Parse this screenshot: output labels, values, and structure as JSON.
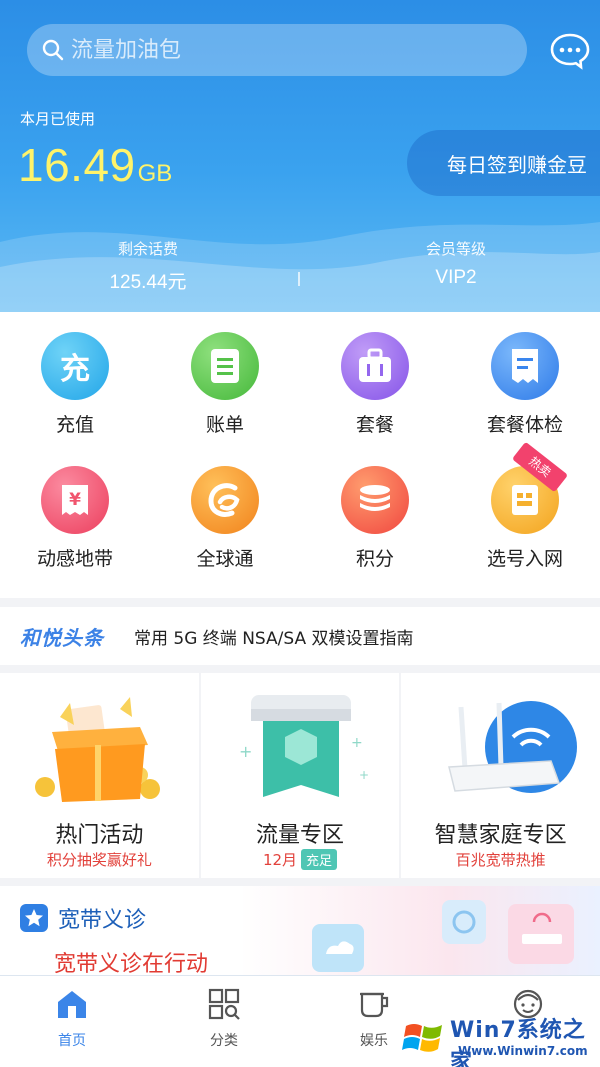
{
  "header": {
    "search_placeholder": "流量加油包",
    "used_label": "本月已使用",
    "used_value": "16.49",
    "used_unit": "GB",
    "checkin_label": "每日签到赚金豆",
    "balance_label": "剩余话费",
    "balance_value": "125.44元",
    "level_label": "会员等级",
    "level_value": "VIP2"
  },
  "grid": {
    "items": [
      {
        "label": "充值",
        "icon": "recharge-icon",
        "glyph": "充",
        "color": "#33b6ec"
      },
      {
        "label": "账单",
        "icon": "bill-icon",
        "color": "#5bc94e"
      },
      {
        "label": "套餐",
        "icon": "plan-icon",
        "color": "#9a6cf0"
      },
      {
        "label": "套餐体检",
        "icon": "plan-check-icon",
        "color": "#3d8ef1"
      },
      {
        "label": "动感地带",
        "icon": "mzone-icon",
        "glyph": "¥",
        "color": "#f0556e"
      },
      {
        "label": "全球通",
        "icon": "gotone-icon",
        "color": "#f59b2a"
      },
      {
        "label": "积分",
        "icon": "points-icon",
        "color": "#f45a4c"
      },
      {
        "label": "选号入网",
        "icon": "choose-number-icon",
        "color": "#f7b12e",
        "badge": "热卖"
      }
    ]
  },
  "news": {
    "brand": "和悦头条",
    "headline": "常用 5G 终端 NSA/SA 双模设置指南"
  },
  "promos": [
    {
      "title": "热门活动",
      "subtitle": "积分抽奖赢好礼"
    },
    {
      "title": "流量专区",
      "subtitle": "12月",
      "badge": "充足"
    },
    {
      "title": "智慧家庭专区",
      "subtitle": "百兆宽带热推"
    }
  ],
  "broadband": {
    "title": "宽带义诊",
    "subtitle": "宽带义诊在行动"
  },
  "tabbar": {
    "tabs": [
      {
        "label": "首页",
        "icon": "home-icon",
        "active": true
      },
      {
        "label": "分类",
        "icon": "category-icon",
        "active": false
      },
      {
        "label": "娱乐",
        "icon": "entertainment-icon",
        "active": false
      },
      {
        "label": "我的",
        "icon": "profile-icon",
        "active": false
      }
    ]
  },
  "watermark": {
    "main": "Win7系统之家",
    "url": "Www.Winwin7.com"
  },
  "colors": {
    "header_top": "#2c8ee6",
    "used_value": "#fff36a",
    "accent_blue": "#3b85e8",
    "accent_red": "#e2413b"
  }
}
